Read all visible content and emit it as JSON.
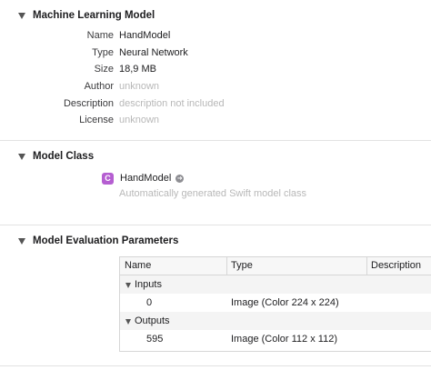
{
  "ml_model": {
    "title": "Machine Learning Model",
    "properties": [
      {
        "label": "Name",
        "value": "HandModel",
        "muted": false
      },
      {
        "label": "Type",
        "value": "Neural Network",
        "muted": false
      },
      {
        "label": "Size",
        "value": "18,9 MB",
        "muted": false
      },
      {
        "label": "Author",
        "value": "unknown",
        "muted": true
      },
      {
        "label": "Description",
        "value": "description not included",
        "muted": true
      },
      {
        "label": "License",
        "value": "unknown",
        "muted": true
      }
    ]
  },
  "model_class": {
    "title": "Model Class",
    "badge": "C",
    "class_name": "HandModel",
    "description": "Automatically generated Swift model class"
  },
  "evaluation": {
    "title": "Model Evaluation Parameters",
    "columns": [
      "Name",
      "Type",
      "Description"
    ],
    "groups": [
      {
        "label": "Inputs",
        "items": [
          {
            "name": "0",
            "type": "Image (Color 224 x 224)",
            "description": ""
          }
        ]
      },
      {
        "label": "Outputs",
        "items": [
          {
            "name": "595",
            "type": "Image (Color 112 x 112)",
            "description": ""
          }
        ]
      }
    ]
  },
  "colors": {
    "class_badge": "#b55ed1",
    "muted_text": "#b8b8b8",
    "separator": "#e2e2e2"
  }
}
